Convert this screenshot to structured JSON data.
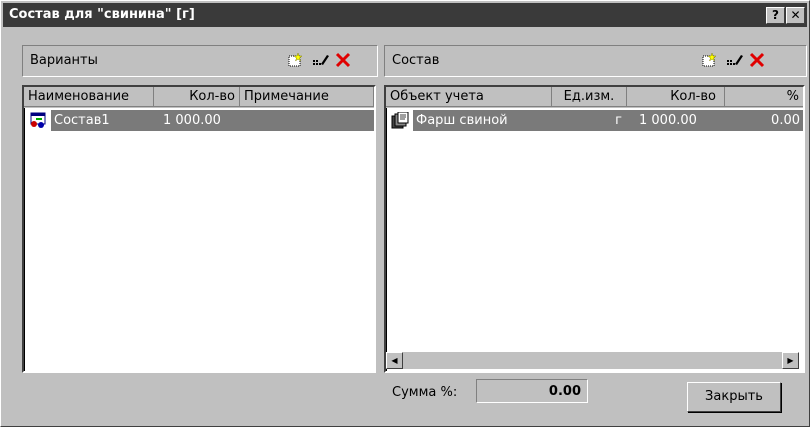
{
  "window": {
    "title": "Состав для \"свинина\" [г]",
    "help_label": "?",
    "close_label": "✕"
  },
  "left_panel": {
    "title": "Варианты",
    "columns": [
      "Наименование",
      "Кол-во",
      "Примечание"
    ],
    "rows": [
      {
        "name": "Состав1",
        "qty": "1 000.00",
        "note": ""
      }
    ]
  },
  "right_panel": {
    "title": "Состав",
    "columns": [
      "Объект учета",
      "Ед.изм.",
      "Кол-во",
      "%"
    ],
    "rows": [
      {
        "object": "Фарш свиной",
        "unit": "г",
        "qty": "1 000.00",
        "pct": "0.00"
      }
    ]
  },
  "footer": {
    "sum_label": "Сумма %:",
    "sum_value": "0.00",
    "close_button": "Закрыть"
  },
  "colors": {
    "title_bg": "#3a3a3a",
    "selection": "#7a7a7a",
    "delete_red": "#e00000"
  }
}
